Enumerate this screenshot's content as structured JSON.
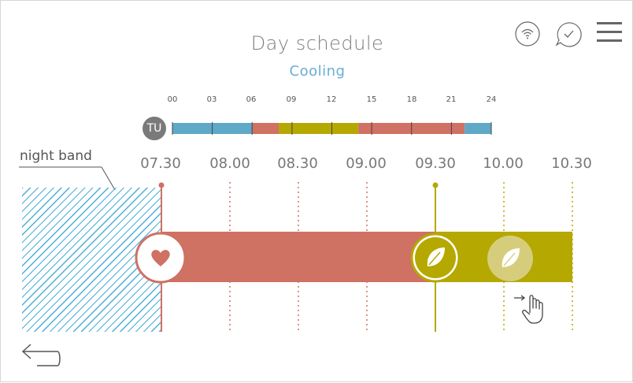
{
  "header": {
    "title": "Day schedule",
    "subtitle": "Cooling"
  },
  "status_icons": {
    "wifi": "wifi-icon",
    "check": "chat-check-icon",
    "menu": "hamburger-menu-icon"
  },
  "day_bar": {
    "day": "TU",
    "hours": [
      "00",
      "03",
      "06",
      "09",
      "12",
      "15",
      "18",
      "21",
      "24"
    ],
    "segments": [
      {
        "from": 0,
        "to": 6,
        "mode": "night"
      },
      {
        "from": 6,
        "to": 8,
        "mode": "comfort"
      },
      {
        "from": 8,
        "to": 14,
        "mode": "eco"
      },
      {
        "from": 14,
        "to": 22,
        "mode": "comfort"
      },
      {
        "from": 22,
        "to": 24,
        "mode": "night"
      }
    ]
  },
  "timeline": {
    "times": [
      "07.30",
      "08.00",
      "08.30",
      "09.00",
      "09.30",
      "10.00",
      "10.30"
    ],
    "night_band_label": "night band",
    "comfort_icon": "heart-icon",
    "eco_icon": "leaf-icon",
    "drag_hint_icon": "drag-hand-icon",
    "comfort_from": "07.30",
    "eco_from": "09.30",
    "eco_preview_from": "10.00"
  },
  "colors": {
    "night": "#5fa8c8",
    "comfort": "#cf7163",
    "eco": "#b5a800",
    "text_gray": "#7d7d7d",
    "accent_blue": "#6aaed3"
  },
  "navigation": {
    "back_icon": "back-arrow-icon"
  }
}
